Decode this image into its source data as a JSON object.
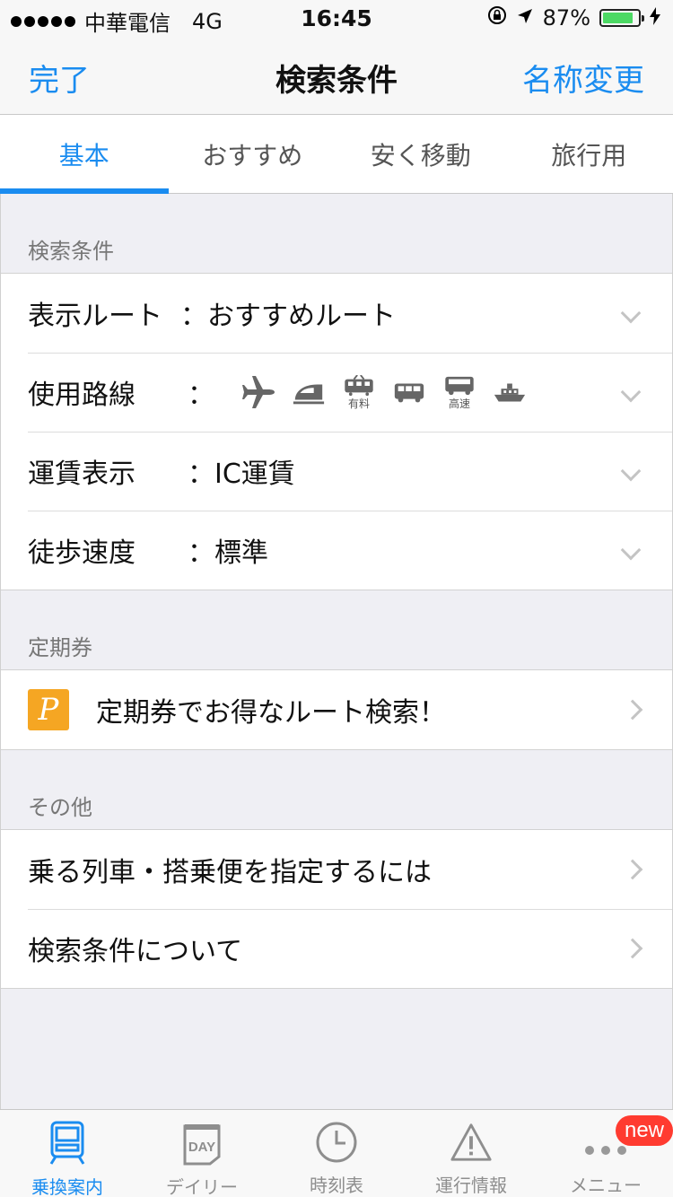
{
  "status_bar": {
    "carrier": "中華電信",
    "network": "4G",
    "time": "16:45",
    "battery_percent": "87%",
    "battery_level": 0.87
  },
  "nav": {
    "left": "完了",
    "title": "検索条件",
    "right": "名称変更"
  },
  "tabs": [
    {
      "label": "基本",
      "active": true
    },
    {
      "label": "おすすめ",
      "active": false
    },
    {
      "label": "安く移動",
      "active": false
    },
    {
      "label": "旅行用",
      "active": false
    }
  ],
  "sections": {
    "search_conditions": {
      "header": "検索条件",
      "rows": {
        "route_display": {
          "label": "表示ルート",
          "value": "：おすすめルート"
        },
        "lines_used": {
          "label": "使用路線",
          "separator": "：",
          "icons": [
            "airplane-icon",
            "shinkansen-icon",
            "limited-express-icon",
            "bus-icon",
            "highway-bus-icon",
            "ferry-icon"
          ],
          "paid_label": "有料",
          "highway_label": "高速"
        },
        "fare_display": {
          "label": "運賃表示",
          "value": "：IC運賃"
        },
        "walk_speed": {
          "label": "徒歩速度",
          "value": "：標準"
        }
      }
    },
    "commuter": {
      "header": "定期券",
      "row_label": "定期券でお得なルート検索！",
      "icon_letter": "P"
    },
    "other": {
      "header": "その他",
      "rows": [
        "乗る列車・搭乗便を指定するには",
        "検索条件について"
      ]
    }
  },
  "tab_bar": {
    "items": [
      {
        "label": "乗換案内",
        "icon": "train-icon",
        "active": true
      },
      {
        "label": "デイリー",
        "icon": "calendar-day-icon",
        "day_text": "DAY"
      },
      {
        "label": "時刻表",
        "icon": "clock-icon"
      },
      {
        "label": "運行情報",
        "icon": "warning-icon"
      },
      {
        "label": "メニュー",
        "icon": "more-icon",
        "badge": "new"
      }
    ]
  },
  "colors": {
    "accent": "#1a8cf0",
    "background": "#efeff4",
    "badge": "#ff3b30",
    "commuter_icon": "#f5a623"
  }
}
